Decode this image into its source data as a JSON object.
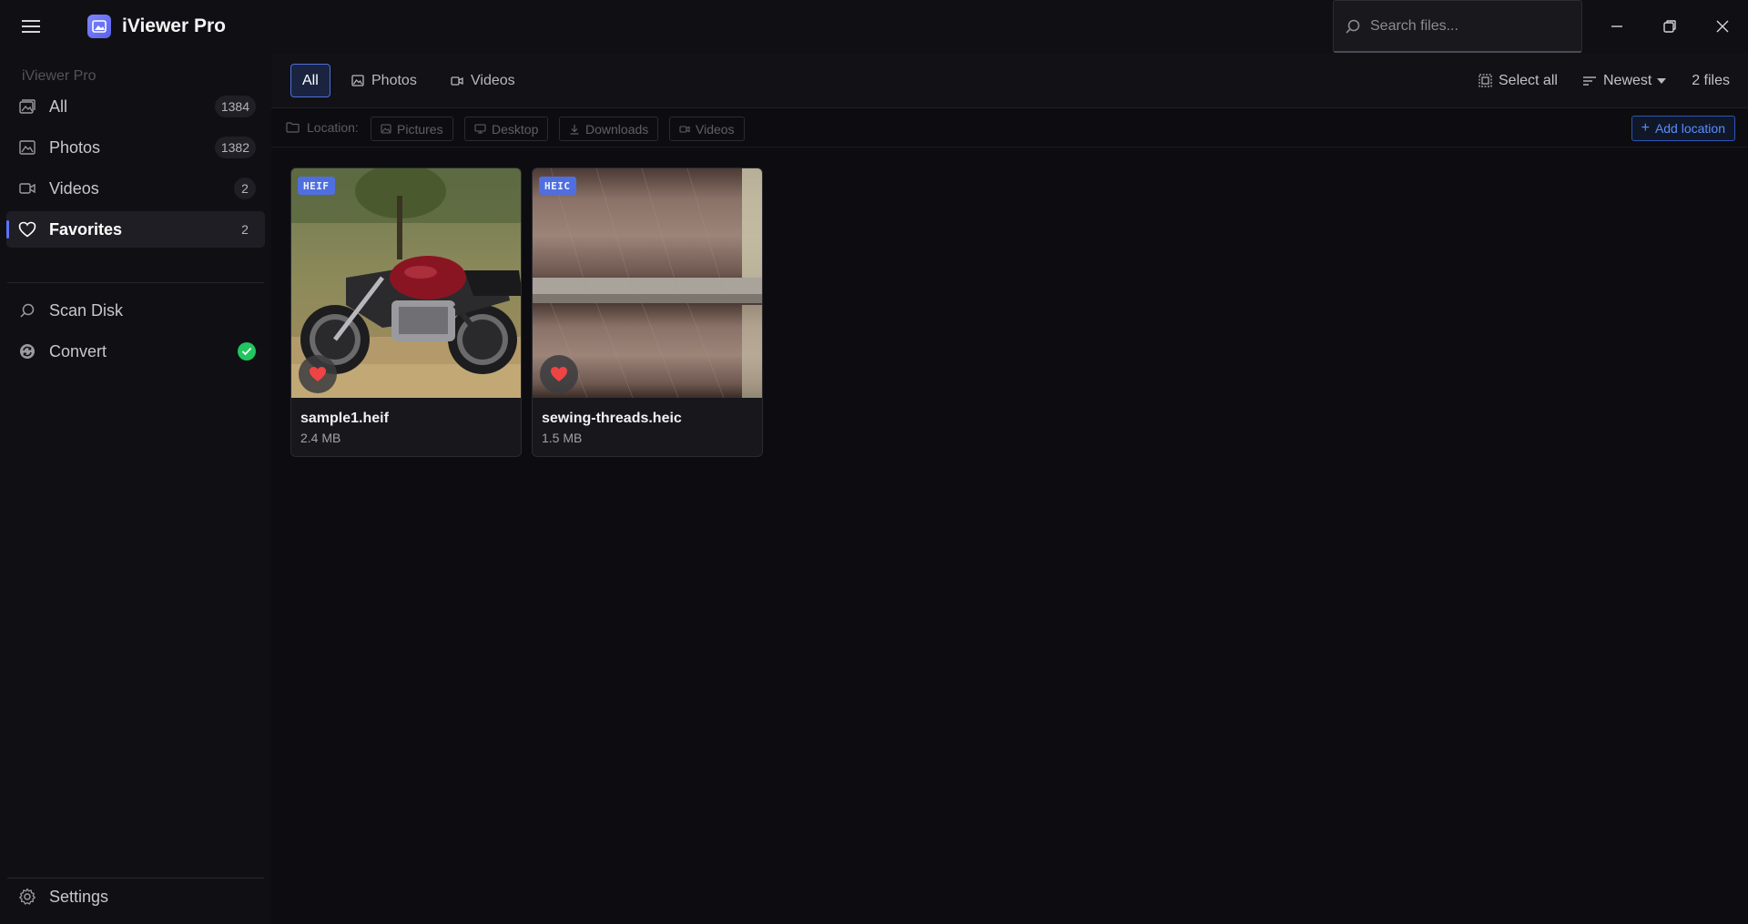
{
  "app": {
    "title": "iViewer Pro"
  },
  "search": {
    "placeholder": "Search files..."
  },
  "sidebar": {
    "heading": "iViewer Pro",
    "items": [
      {
        "label": "All",
        "count": "1384",
        "icon": "gallery-icon"
      },
      {
        "label": "Photos",
        "count": "1382",
        "icon": "image-icon"
      },
      {
        "label": "Videos",
        "count": "2",
        "icon": "video-icon"
      },
      {
        "label": "Favorites",
        "count": "2",
        "icon": "heart-icon",
        "active": true
      }
    ],
    "tools": [
      {
        "label": "Scan Disk",
        "icon": "search-icon"
      },
      {
        "label": "Convert",
        "icon": "convert-icon",
        "status": "ok"
      }
    ],
    "settings_label": "Settings"
  },
  "toolbar": {
    "tabs": [
      {
        "label": "All",
        "active": true
      },
      {
        "label": "Photos",
        "icon": "image-icon"
      },
      {
        "label": "Videos",
        "icon": "video-icon"
      }
    ],
    "select_all": "Select all",
    "sort": "Newest",
    "file_count": "2 files"
  },
  "locations": {
    "label": "Location:",
    "chips": [
      "Pictures",
      "Desktop",
      "Downloads",
      "Videos"
    ],
    "add_label": "Add location"
  },
  "files": [
    {
      "name": "sample1.heif",
      "size": "2.4 MB",
      "format": "HEIF",
      "favorite": true
    },
    {
      "name": "sewing-threads.heic",
      "size": "1.5 MB",
      "format": "HEIC",
      "favorite": true
    }
  ],
  "colors": {
    "accent": "#5b73ff",
    "favorite": "#ef4444",
    "status_ok": "#22c55e"
  }
}
